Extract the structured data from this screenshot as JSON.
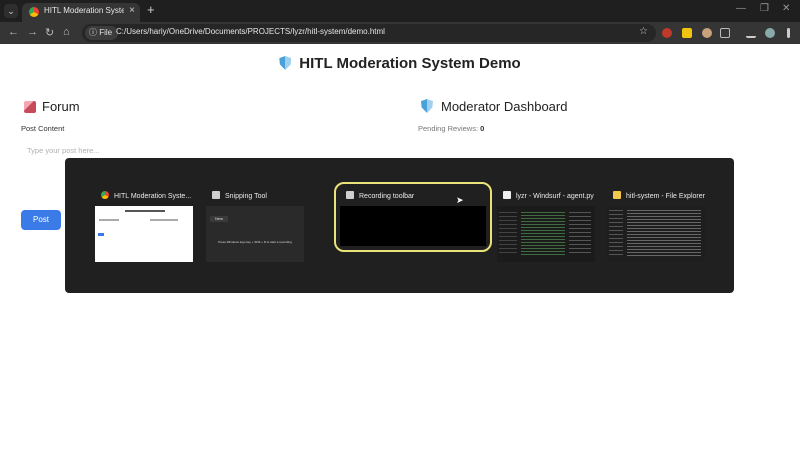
{
  "browser": {
    "tab_title": "HITL Moderation System - Dem",
    "tab_close": "×",
    "new_tab": "+",
    "scheme_chip": "File",
    "url": "C:/Users/hariy/OneDrive/Documents/PROJECTS/lyzr/hitl-system/demo.html"
  },
  "page": {
    "title": "HITL Moderation System Demo",
    "forum": {
      "heading": "Forum",
      "post_content_label": "Post Content",
      "placeholder": "Type your post here...",
      "post_button": "Post"
    },
    "moderator": {
      "heading": "Moderator Dashboard",
      "pending_label": "Pending Reviews:",
      "pending_count": "0"
    }
  },
  "switcher": {
    "windows": [
      {
        "title": "HITL Moderation Syste...",
        "icon": "chrome-icon",
        "selected": false
      },
      {
        "title": "Snipping Tool",
        "icon": "snipping-tool-icon",
        "selected": false
      },
      {
        "title": "Recording toolbar",
        "icon": "recording-icon",
        "selected": true
      },
      {
        "title": "lyzr - Windsurf - agent.py",
        "icon": "windsurf-icon",
        "selected": false
      },
      {
        "title": "hitl-system - File Explorer",
        "icon": "folder-icon",
        "selected": false
      }
    ],
    "snipping_hint": "Press Windows logo key + Shift + R to start a recording",
    "snipping_new": "New"
  }
}
